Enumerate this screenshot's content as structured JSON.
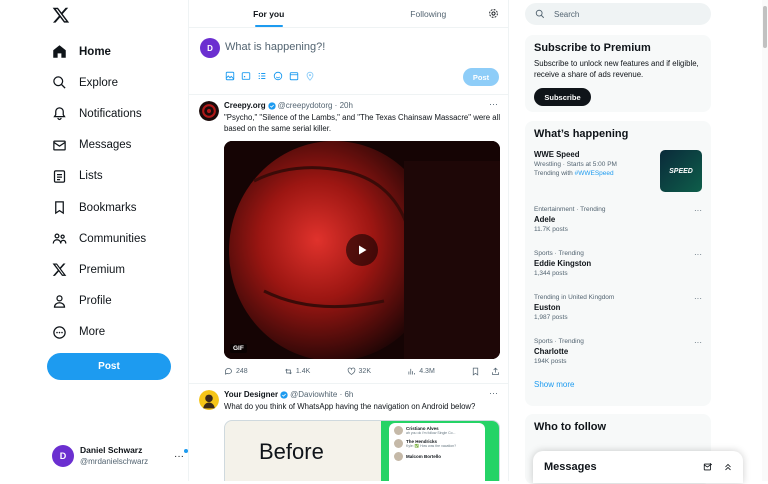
{
  "nav": {
    "items": [
      {
        "label": "Home",
        "icon": "home-icon",
        "active": true
      },
      {
        "label": "Explore",
        "icon": "search-icon"
      },
      {
        "label": "Notifications",
        "icon": "bell-icon"
      },
      {
        "label": "Messages",
        "icon": "mail-icon"
      },
      {
        "label": "Lists",
        "icon": "list-icon"
      },
      {
        "label": "Bookmarks",
        "icon": "bookmark-icon"
      },
      {
        "label": "Communities",
        "icon": "communities-icon"
      },
      {
        "label": "Premium",
        "icon": "x-icon"
      },
      {
        "label": "Profile",
        "icon": "person-icon"
      },
      {
        "label": "More",
        "icon": "more-circle-icon"
      }
    ],
    "post_label": "Post"
  },
  "account": {
    "initial": "D",
    "name": "Daniel Schwarz",
    "handle": "@mrdanielschwarz",
    "more": "···"
  },
  "tabs": {
    "for_you": "For you",
    "following": "Following"
  },
  "compose": {
    "initial": "D",
    "placeholder": "What is happening?!",
    "post_label": "Post"
  },
  "tweet1": {
    "name": "Creepy.org",
    "handle": "@creepydotorg · 20h",
    "text": "\"Psycho,\" \"Silence of the Lambs,\" and \"The Texas Chainsaw Massacre\" were all based on the same serial killer.",
    "gif_label": "GIF",
    "replies": "248",
    "reposts": "1.4K",
    "likes": "32K",
    "views": "4.3M",
    "more": "···"
  },
  "tweet2": {
    "name": "Your Designer",
    "handle": "@Daviowhite · 6h",
    "text": "What do you think of WhatsApp having the navigation on Android below?",
    "media_text": "Before",
    "chats": [
      {
        "name": "Cristiano Alves",
        "msg": "ah you ok i'm follow Single Co..."
      },
      {
        "name": "The Hendricks",
        "msg": "Kyle: ✅ How was the vacation?"
      },
      {
        "name": "Malcom Bortello",
        "msg": ""
      }
    ],
    "more": "···"
  },
  "search": {
    "placeholder": "Search"
  },
  "premium": {
    "title": "Subscribe to Premium",
    "text": "Subscribe to unlock new features and if eligible, receive a share of ads revenue.",
    "button": "Subscribe"
  },
  "happening": {
    "title": "What’s happening",
    "featured": {
      "name": "WWE Speed",
      "meta": "Wrestling · Starts at 5:00 PM",
      "trending_prefix": "Trending with",
      "hashtag": "#WWESpeed",
      "thumb_text": "SPEED"
    },
    "trends": [
      {
        "category": "Entertainment · Trending",
        "name": "Adele",
        "posts": "11.7K posts"
      },
      {
        "category": "Sports · Trending",
        "name": "Eddie Kingston",
        "posts": "1,344 posts"
      },
      {
        "category": "Trending in United Kingdom",
        "name": "Euston",
        "posts": "1,987 posts"
      },
      {
        "category": "Sports · Trending",
        "name": "Charlotte",
        "posts": "194K posts"
      }
    ],
    "show_more": "Show more"
  },
  "who_to_follow": {
    "title": "Who to follow"
  },
  "messages_drawer": {
    "title": "Messages"
  },
  "colors": {
    "accent": "#1d9bf0",
    "text": "#0f1419",
    "muted": "#536471",
    "card": "#f7f9f9"
  }
}
